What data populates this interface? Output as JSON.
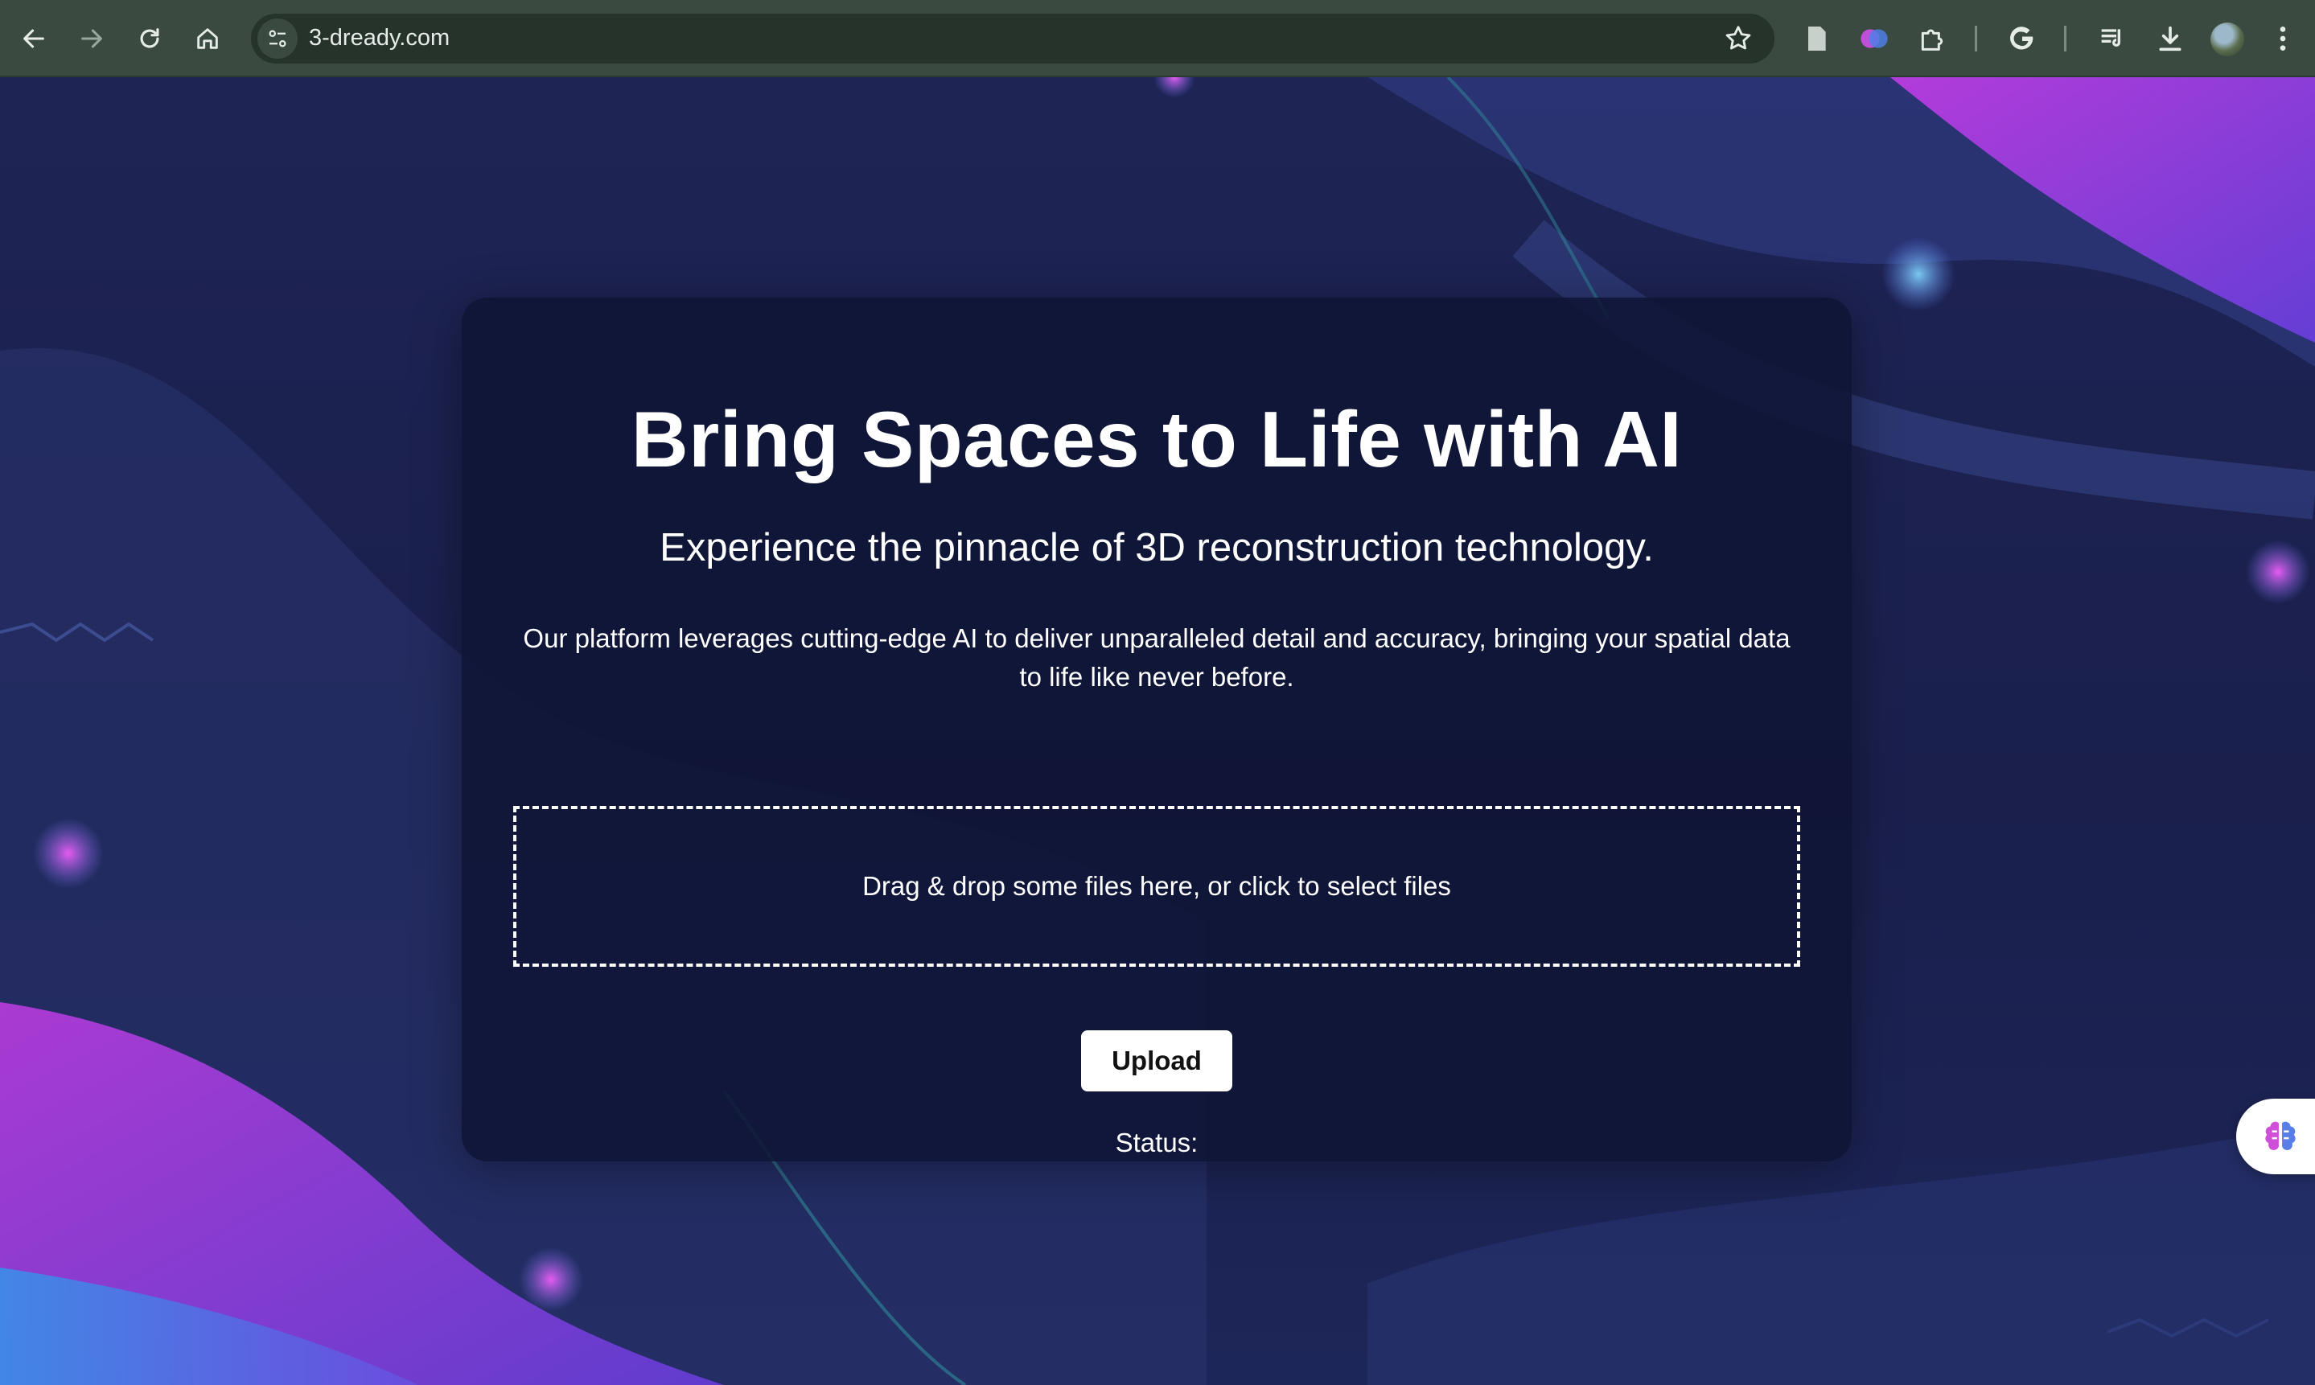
{
  "browser": {
    "url": "3-dready.com",
    "icons": {
      "back": "back-arrow-icon",
      "forward": "forward-arrow-icon",
      "reload": "reload-icon",
      "home": "home-icon",
      "site_info": "tune-icon",
      "bookmark": "star-icon",
      "extensions": [
        "document-icon",
        "brain-extension-icon",
        "puzzle-extensions-icon",
        "google-icon",
        "reading-list-icon",
        "download-icon",
        "profile-avatar",
        "more-menu-icon"
      ]
    }
  },
  "hero": {
    "title": "Bring Spaces to Life with AI",
    "subtitle": "Experience the pinnacle of 3D reconstruction technology.",
    "description": "Our platform leverages cutting-edge AI to deliver unparalleled detail and accuracy, bringing your spatial data to life like never before."
  },
  "upload": {
    "dropzone_text": "Drag & drop some files here, or click to select files",
    "button_label": "Upload",
    "status_label": "Status:"
  },
  "colors": {
    "background": "#1c2250",
    "card": "#0f1534",
    "accent_purple": "#a33be0",
    "accent_cyan": "#3fb8e8"
  }
}
